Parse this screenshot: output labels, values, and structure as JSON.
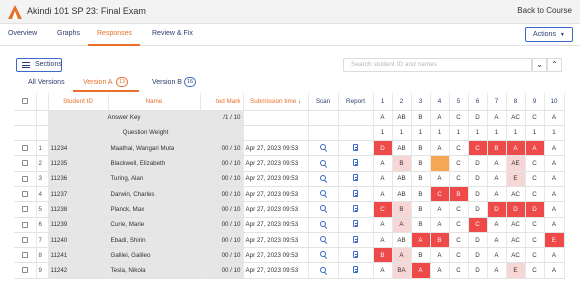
{
  "header": {
    "title": "Akindi 101 SP 23: Final Exam",
    "back_label": "Back to Course"
  },
  "nav": {
    "tabs": [
      "Overview",
      "Graphs",
      "Responses",
      "Review & Fix"
    ],
    "actions_label": "Actions"
  },
  "toolbar": {
    "sections_label": "Sections",
    "search_placeholder": "Search student ID and names"
  },
  "versions": {
    "all_label": "All Versions",
    "a_label": "Version A",
    "a_count": "13",
    "b_label": "Version B",
    "b_count": "16"
  },
  "columns": {
    "student_id": "Student ID",
    "name": "Name",
    "adjusted_mark": "ted Mark",
    "submission_time": "Submission time",
    "scan": "Scan",
    "report": "Report",
    "questions": [
      "1",
      "2",
      "3",
      "4",
      "5",
      "6",
      "7",
      "8",
      "9",
      "10"
    ]
  },
  "answer_key": {
    "label": "Answer Key",
    "mark": "/1 / 10",
    "answers": [
      "A",
      "AB",
      "B",
      "A",
      "C",
      "D",
      "A",
      "AC",
      "C",
      "A"
    ]
  },
  "question_weight": {
    "label": "Question Weight",
    "weights": [
      "1",
      "1",
      "1",
      "1",
      "1",
      "1",
      "1",
      "1",
      "1",
      "1"
    ]
  },
  "rows": [
    {
      "num": "1",
      "id": "11234",
      "name": "Maathai, Wangari Muta",
      "mark": "00 / 10",
      "time": "Apr 27, 2023 09:53",
      "answers": [
        "D",
        "AB",
        "B",
        "A",
        "C",
        "C",
        "B",
        "A",
        "A",
        "A"
      ]
    },
    {
      "num": "2",
      "id": "11235",
      "name": "Blackwell, Elizabeth",
      "mark": "00 / 10",
      "time": "Apr 27, 2023 09:53",
      "answers": [
        "A",
        "B",
        "B",
        "",
        "C",
        "D",
        "A",
        "AE",
        "C",
        "A"
      ]
    },
    {
      "num": "3",
      "id": "11236",
      "name": "Turing, Alan",
      "mark": "00 / 10",
      "time": "Apr 27, 2023 09:53",
      "answers": [
        "A",
        "AB",
        "B",
        "A",
        "C",
        "D",
        "A",
        "E",
        "C",
        "A"
      ]
    },
    {
      "num": "4",
      "id": "11237",
      "name": "Darwin, Charles",
      "mark": "00 / 10",
      "time": "Apr 27, 2023 09:53",
      "answers": [
        "A",
        "AB",
        "B",
        "C",
        "B",
        "D",
        "A",
        "AC",
        "C",
        "A"
      ]
    },
    {
      "num": "5",
      "id": "11238",
      "name": "Planck, Max",
      "mark": "00 / 10",
      "time": "Apr 27, 2023 09:53",
      "answers": [
        "C",
        "B",
        "B",
        "A",
        "C",
        "D",
        "D",
        "D",
        "D",
        "A"
      ]
    },
    {
      "num": "6",
      "id": "11239",
      "name": "Curie, Marie",
      "mark": "00 / 10",
      "time": "Apr 27, 2023 09:53",
      "answers": [
        "A",
        "A",
        "B",
        "A",
        "C",
        "C",
        "A",
        "AC",
        "C",
        "A"
      ]
    },
    {
      "num": "7",
      "id": "11240",
      "name": "Ebadi, Shirin",
      "mark": "00 / 10",
      "time": "Apr 27, 2023 09:53",
      "answers": [
        "A",
        "AB",
        "A",
        "B",
        "C",
        "D",
        "A",
        "AC",
        "C",
        "E"
      ]
    },
    {
      "num": "8",
      "id": "11241",
      "name": "Galilei, Galileo",
      "mark": "00 / 10",
      "time": "Apr 27, 2023 09:53",
      "answers": [
        "B",
        "A",
        "B",
        "A",
        "C",
        "D",
        "A",
        "AC",
        "C",
        "A"
      ]
    },
    {
      "num": "9",
      "id": "11242",
      "name": "Tesla, Nikola",
      "mark": "00 / 10",
      "time": "Apr 27, 2023 09:53",
      "answers": [
        "A",
        "BA",
        "A",
        "A",
        "C",
        "D",
        "A",
        "E",
        "C",
        "A"
      ]
    }
  ],
  "cell_states": [
    [
      "red",
      "white",
      "white",
      "white",
      "white",
      "red",
      "red",
      "red",
      "red",
      "white"
    ],
    [
      "white",
      "pink",
      "white",
      "amber",
      "white",
      "white",
      "white",
      "pink",
      "white",
      "white"
    ],
    [
      "white",
      "white",
      "white",
      "white",
      "white",
      "white",
      "white",
      "pink",
      "white",
      "white"
    ],
    [
      "white",
      "white",
      "white",
      "red",
      "red",
      "white",
      "white",
      "white",
      "white",
      "white"
    ],
    [
      "red",
      "pink",
      "white",
      "white",
      "white",
      "white",
      "red",
      "red",
      "red",
      "white"
    ],
    [
      "white",
      "pink",
      "white",
      "white",
      "white",
      "red",
      "white",
      "white",
      "white",
      "white"
    ],
    [
      "white",
      "white",
      "red",
      "red",
      "white",
      "white",
      "white",
      "white",
      "white",
      "red"
    ],
    [
      "red",
      "pink",
      "white",
      "white",
      "white",
      "white",
      "white",
      "white",
      "white",
      "white"
    ],
    [
      "white",
      "pink",
      "red",
      "white",
      "white",
      "white",
      "white",
      "pink",
      "white",
      "white"
    ]
  ],
  "colors": {
    "accent": "#e8702a",
    "link": "#2a3d6e",
    "incorrect": "#ef4a4a",
    "partial": "#f7d6d6",
    "blank": "#f5a755"
  },
  "icons": {
    "logo": "akindi-logo",
    "scan": "search-icon",
    "report": "document-icon"
  }
}
